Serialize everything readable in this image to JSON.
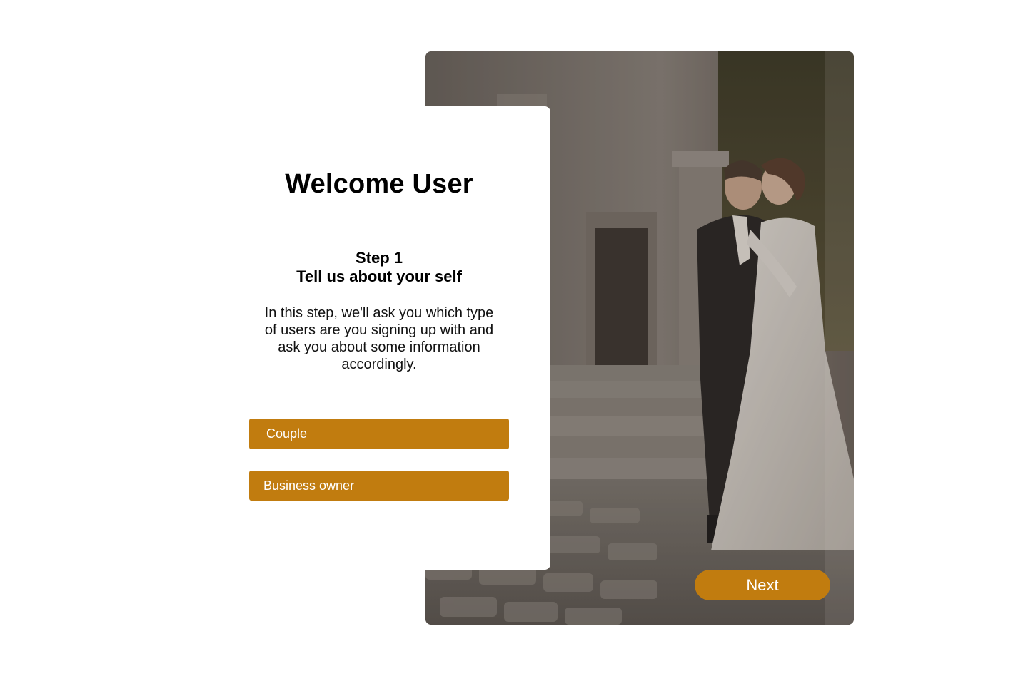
{
  "welcome": {
    "title": "Welcome User"
  },
  "step": {
    "number_label": "Step 1",
    "heading": "Tell us about your self",
    "description": "In this step, we'll ask you which type of users are you signing up with and ask you about some information accordingly."
  },
  "options": [
    {
      "label": "Couple"
    },
    {
      "label": "Business owner"
    }
  ],
  "navigation": {
    "next_label": "Next"
  },
  "colors": {
    "accent": "#c17c0f",
    "card_background": "#ffffff",
    "page_background": "#ffffff"
  },
  "images": {
    "hero": "wedding-couple-photo"
  }
}
